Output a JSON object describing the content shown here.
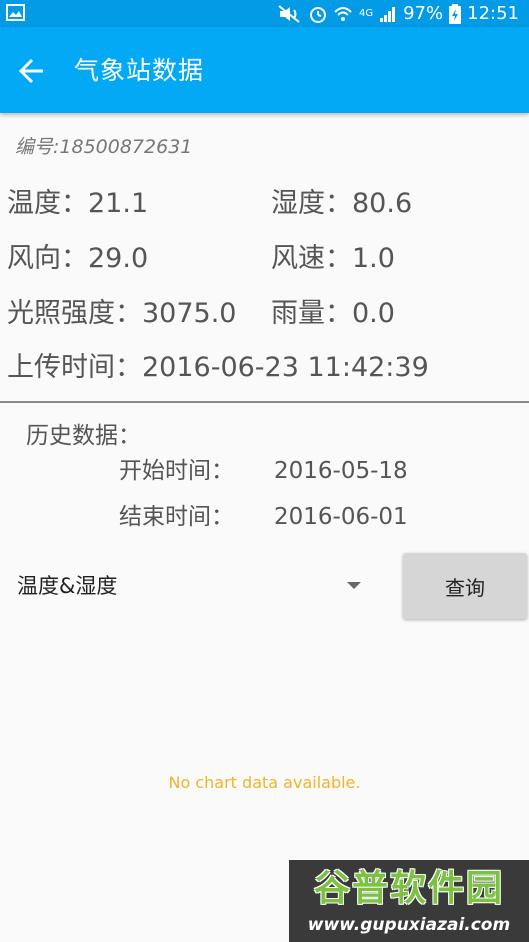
{
  "status_bar": {
    "battery": "97%",
    "time": "12:51",
    "network": "4G",
    "icons": [
      "image-icon",
      "mute-icon",
      "alarm-icon",
      "wifi-icon",
      "signal-icon",
      "battery-icon"
    ]
  },
  "app_bar": {
    "title": "气象站数据",
    "back_icon": "arrow-left-icon"
  },
  "station": {
    "device_id": "编号:18500872631",
    "temperature": "温度：21.1",
    "humidity": "湿度：80.6",
    "wind_direction": "风向：29.0",
    "wind_speed": "风速：1.0",
    "illuminance": "光照强度：3075.0",
    "rainfall": "雨量：0.0",
    "upload_time": "上传时间：2016-06-23 11:42:39"
  },
  "history": {
    "label": "历史数据：",
    "start_label": "开始时间：",
    "start_value": "2016-05-18",
    "end_label": "结束时间：",
    "end_value": "2016-06-01",
    "selected_metric": "温度&湿度",
    "query_button": "查询",
    "empty_message": "No chart data available."
  },
  "watermark": {
    "brand": "谷普软件园",
    "url": "www.gupuxiazai.com"
  },
  "colors": {
    "status_bar": "#039be5",
    "app_bar": "#03a9f4",
    "empty_message": "#f0b428"
  }
}
